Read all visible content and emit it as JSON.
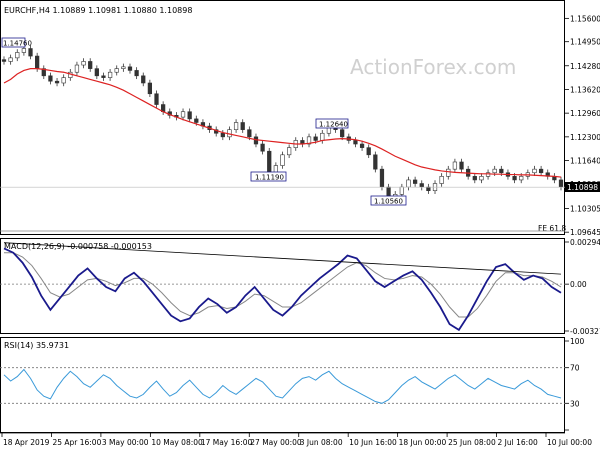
{
  "watermark": "ActionForex.com",
  "chart_data": [
    {
      "type": "candlestick",
      "pane": "price",
      "header": "EURCHF,H4  1.10889 1.10981 1.10880 1.10898",
      "ylim": [
        1.0965,
        1.16
      ],
      "y_ticks": [
        "1.15600",
        "1.14950",
        "1.14280",
        "1.13620",
        "1.12960",
        "1.12300",
        "1.11640",
        "1.10980",
        "1.10305",
        "1.09645"
      ],
      "current_price_label": "1.10898",
      "fe_label": "FE 61.8",
      "annotations": [
        "1.14760",
        "1.12640",
        "1.11190",
        "1.10560"
      ],
      "series_close": [
        1.144,
        1.145,
        1.1465,
        1.1476,
        1.1455,
        1.142,
        1.14,
        1.1385,
        1.138,
        1.1395,
        1.141,
        1.143,
        1.144,
        1.142,
        1.14,
        1.1395,
        1.141,
        1.142,
        1.1425,
        1.1415,
        1.14,
        1.138,
        1.135,
        1.132,
        1.13,
        1.129,
        1.1285,
        1.13,
        1.128,
        1.127,
        1.126,
        1.125,
        1.124,
        1.123,
        1.125,
        1.127,
        1.125,
        1.123,
        1.121,
        1.119,
        1.1119,
        1.115,
        1.118,
        1.12,
        1.122,
        1.121,
        1.123,
        1.122,
        1.124,
        1.1264,
        1.125,
        1.123,
        1.122,
        1.121,
        1.12,
        1.118,
        1.114,
        1.109,
        1.1056,
        1.107,
        1.109,
        1.111,
        1.11,
        1.109,
        1.108,
        1.11,
        1.112,
        1.114,
        1.116,
        1.114,
        1.112,
        1.111,
        1.112,
        1.113,
        1.114,
        1.113,
        1.112,
        1.111,
        1.112,
        1.113,
        1.114,
        1.113,
        1.112,
        1.111,
        1.109
      ],
      "moving_average": [
        1.138,
        1.139,
        1.1405,
        1.1415,
        1.142,
        1.142,
        1.1418,
        1.1415,
        1.1412,
        1.141,
        1.1405,
        1.14,
        1.1395,
        1.139,
        1.1385,
        1.138,
        1.1375,
        1.1368,
        1.136,
        1.135,
        1.134,
        1.133,
        1.132,
        1.131,
        1.13,
        1.1292,
        1.1285,
        1.1278,
        1.1272,
        1.1266,
        1.126,
        1.1254,
        1.1248,
        1.1242,
        1.1238,
        1.1234,
        1.123,
        1.1226,
        1.1222,
        1.122,
        1.1218,
        1.1216,
        1.1214,
        1.1212,
        1.121,
        1.121,
        1.1212,
        1.1215,
        1.122,
        1.1222,
        1.1224,
        1.1225,
        1.1224,
        1.1222,
        1.1218,
        1.1212,
        1.1205,
        1.1196,
        1.1186,
        1.1176,
        1.1168,
        1.116,
        1.1152,
        1.1146,
        1.1142,
        1.1138,
        1.1135,
        1.1133,
        1.1131,
        1.113,
        1.1129,
        1.1128,
        1.1127,
        1.1127,
        1.1126,
        1.1126,
        1.1125,
        1.1125,
        1.1124,
        1.1124,
        1.1123,
        1.1122,
        1.1121,
        1.112,
        1.1118
      ],
      "colors": {
        "candle": "#333333",
        "moving_average": "#dd2222",
        "annotation_bg": "#ffffff",
        "annotation_border": "#1c1c8c"
      }
    },
    {
      "type": "line",
      "pane": "macd",
      "header": "MACD(12,26,9) -0.000758 -0.000153",
      "ylim": [
        -0.003278,
        0.002949
      ],
      "y_ticks": [
        "0.002949",
        "0.00",
        "-0.003278"
      ],
      "series": [
        {
          "name": "MACD",
          "values": [
            0.0025,
            0.0022,
            0.0015,
            0.0005,
            -0.0008,
            -0.0018,
            -0.001,
            -0.0002,
            0.0006,
            0.0011,
            0.0004,
            -0.0002,
            -0.0005,
            0.0004,
            0.0008,
            0.0002,
            -0.0006,
            -0.0014,
            -0.0022,
            -0.0026,
            -0.0024,
            -0.0016,
            -0.001,
            -0.0014,
            -0.002,
            -0.0016,
            -0.0008,
            -0.0002,
            -0.001,
            -0.0018,
            -0.0022,
            -0.0016,
            -0.0008,
            -0.0002,
            0.0004,
            0.0009,
            0.0014,
            0.002,
            0.0018,
            0.001,
            0.0002,
            -0.0002,
            0.0002,
            0.0006,
            0.0009,
            0.0003,
            -0.0006,
            -0.0016,
            -0.0028,
            -0.0032,
            -0.0022,
            -0.001,
            0.0002,
            0.0012,
            0.0014,
            0.0008,
            0.0003,
            0.0006,
            0.0004,
            -0.0002,
            -0.0006
          ]
        },
        {
          "name": "Signal",
          "values": [
            0.0022,
            0.0022,
            0.0019,
            0.0013,
            0.0004,
            -0.0006,
            -0.0009,
            -0.0007,
            -0.0002,
            0.0003,
            0.0004,
            0.0002,
            -0.0001,
            0.0001,
            0.0004,
            0.0004,
            0.0,
            -0.0006,
            -0.0013,
            -0.0019,
            -0.0022,
            -0.002,
            -0.0016,
            -0.0015,
            -0.0017,
            -0.0016,
            -0.0012,
            -0.0007,
            -0.0008,
            -0.0012,
            -0.0016,
            -0.0016,
            -0.0013,
            -0.0008,
            -0.0003,
            0.0002,
            0.0007,
            0.0012,
            0.0015,
            0.0013,
            0.0008,
            0.0004,
            0.0003,
            0.0004,
            0.0006,
            0.0005,
            0.0,
            -0.0007,
            -0.0016,
            -0.0023,
            -0.0023,
            -0.0017,
            -0.0008,
            0.0002,
            0.0008,
            0.0008,
            0.0006,
            0.0006,
            0.0005,
            0.0002,
            -0.0002
          ]
        }
      ],
      "trendline": [
        0.0029,
        0.0007
      ],
      "colors": {
        "macd": "#1a1a8c",
        "signal": "#888888",
        "trendline": "#000000",
        "zero": "#777777"
      }
    },
    {
      "type": "line",
      "pane": "rsi",
      "header": "RSI(14) 35.9731",
      "ylim": [
        0,
        100
      ],
      "y_ticks": [
        "100",
        "70",
        "30",
        "0"
      ],
      "series": [
        {
          "name": "RSI(14)",
          "values": [
            62,
            55,
            60,
            68,
            58,
            45,
            38,
            35,
            48,
            58,
            66,
            60,
            52,
            48,
            55,
            62,
            58,
            50,
            44,
            38,
            36,
            40,
            48,
            55,
            46,
            38,
            42,
            50,
            56,
            48,
            40,
            36,
            42,
            50,
            44,
            40,
            46,
            52,
            58,
            54,
            46,
            38,
            36,
            44,
            52,
            58,
            60,
            56,
            62,
            66,
            58,
            52,
            48,
            44,
            40,
            36,
            32,
            30,
            34,
            42,
            50,
            56,
            60,
            54,
            50,
            46,
            52,
            58,
            62,
            56,
            50,
            46,
            52,
            58,
            54,
            50,
            48,
            46,
            52,
            56,
            50,
            46,
            40,
            38,
            36
          ]
        }
      ],
      "levels": [
        70,
        30
      ],
      "colors": {
        "rsi": "#3a9ad9",
        "level": "#777777"
      }
    }
  ],
  "x_axis": {
    "labels": [
      "18 Apr 2019",
      "25 Apr 16:00",
      "3 May 00:00",
      "10 May 08:00",
      "17 May 16:00",
      "27 May 00:00",
      "3 Jun 08:00",
      "10 Jun 16:00",
      "18 Jun 00:00",
      "25 Jun 08:00",
      "2 Jul 16:00",
      "10 Jul 00:00"
    ]
  }
}
